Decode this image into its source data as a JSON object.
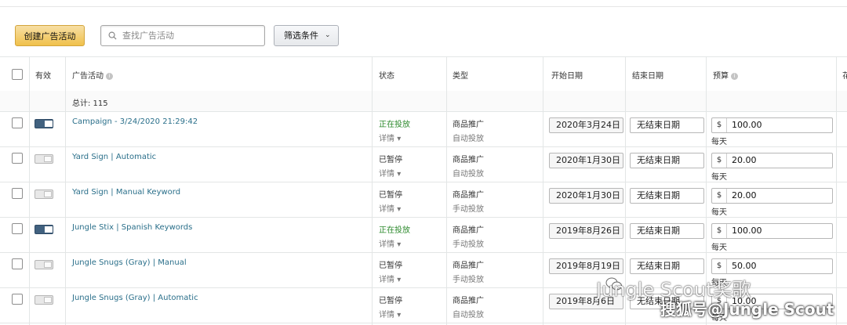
{
  "toolbar": {
    "create_label": "创建广告活动",
    "search_placeholder": "查找广告活动",
    "filter_label": "筛选条件"
  },
  "columns": {
    "active": "有效",
    "campaign": "广告活动",
    "status": "状态",
    "type": "类型",
    "start_date": "开始日期",
    "end_date": "结束日期",
    "budget": "预算",
    "overflow": "花"
  },
  "total_label": "总计: 115",
  "rows": [
    {
      "name": "Campaign - 3/24/2020 21:29:42",
      "active": true,
      "status": "正在投放",
      "status_color": "#2d8a2d",
      "detail": "详情",
      "type": "商品推广",
      "targeting": "自动投放",
      "start": "2020年3月24日",
      "end": "无结束日期",
      "currency": "$",
      "budget": "100.00",
      "period": "每天"
    },
    {
      "name": "Yard Sign | Automatic",
      "active": false,
      "status": "已暂停",
      "status_color": "#333333",
      "detail": "详情",
      "type": "商品推广",
      "targeting": "自动投放",
      "start": "2020年1月30日",
      "end": "无结束日期",
      "currency": "$",
      "budget": "20.00",
      "period": "每天"
    },
    {
      "name": "Yard Sign | Manual Keyword",
      "active": false,
      "status": "已暂停",
      "status_color": "#333333",
      "detail": "详情",
      "type": "商品推广",
      "targeting": "手动投放",
      "start": "2020年1月30日",
      "end": "无结束日期",
      "currency": "$",
      "budget": "20.00",
      "period": "每天"
    },
    {
      "name": "Jungle Stix | Spanish Keywords",
      "active": true,
      "status": "正在投放",
      "status_color": "#2d8a2d",
      "detail": "详情",
      "type": "商品推广",
      "targeting": "手动投放",
      "start": "2019年8月26日",
      "end": "无结束日期",
      "currency": "$",
      "budget": "100.00",
      "period": "每天"
    },
    {
      "name": "Jungle Snugs (Gray) | Manual",
      "active": false,
      "status": "已暂停",
      "status_color": "#333333",
      "detail": "详情",
      "type": "商品推广",
      "targeting": "手动投放",
      "start": "2019年8月19日",
      "end": "无结束日期",
      "currency": "$",
      "budget": "50.00",
      "period": "每天"
    },
    {
      "name": "Jungle Snugs (Gray) | Automatic",
      "active": false,
      "status": "已暂停",
      "status_color": "#333333",
      "detail": "详情",
      "type": "商品推广",
      "targeting": "自动投放",
      "start": "2019年8月6日",
      "end": "无结束日期",
      "currency": "$",
      "budget": "10.00",
      "period": "每天"
    }
  ],
  "watermark": {
    "line1": "Jungle Scout奖歌",
    "line2": "搜狐号@Jungle Scout"
  }
}
